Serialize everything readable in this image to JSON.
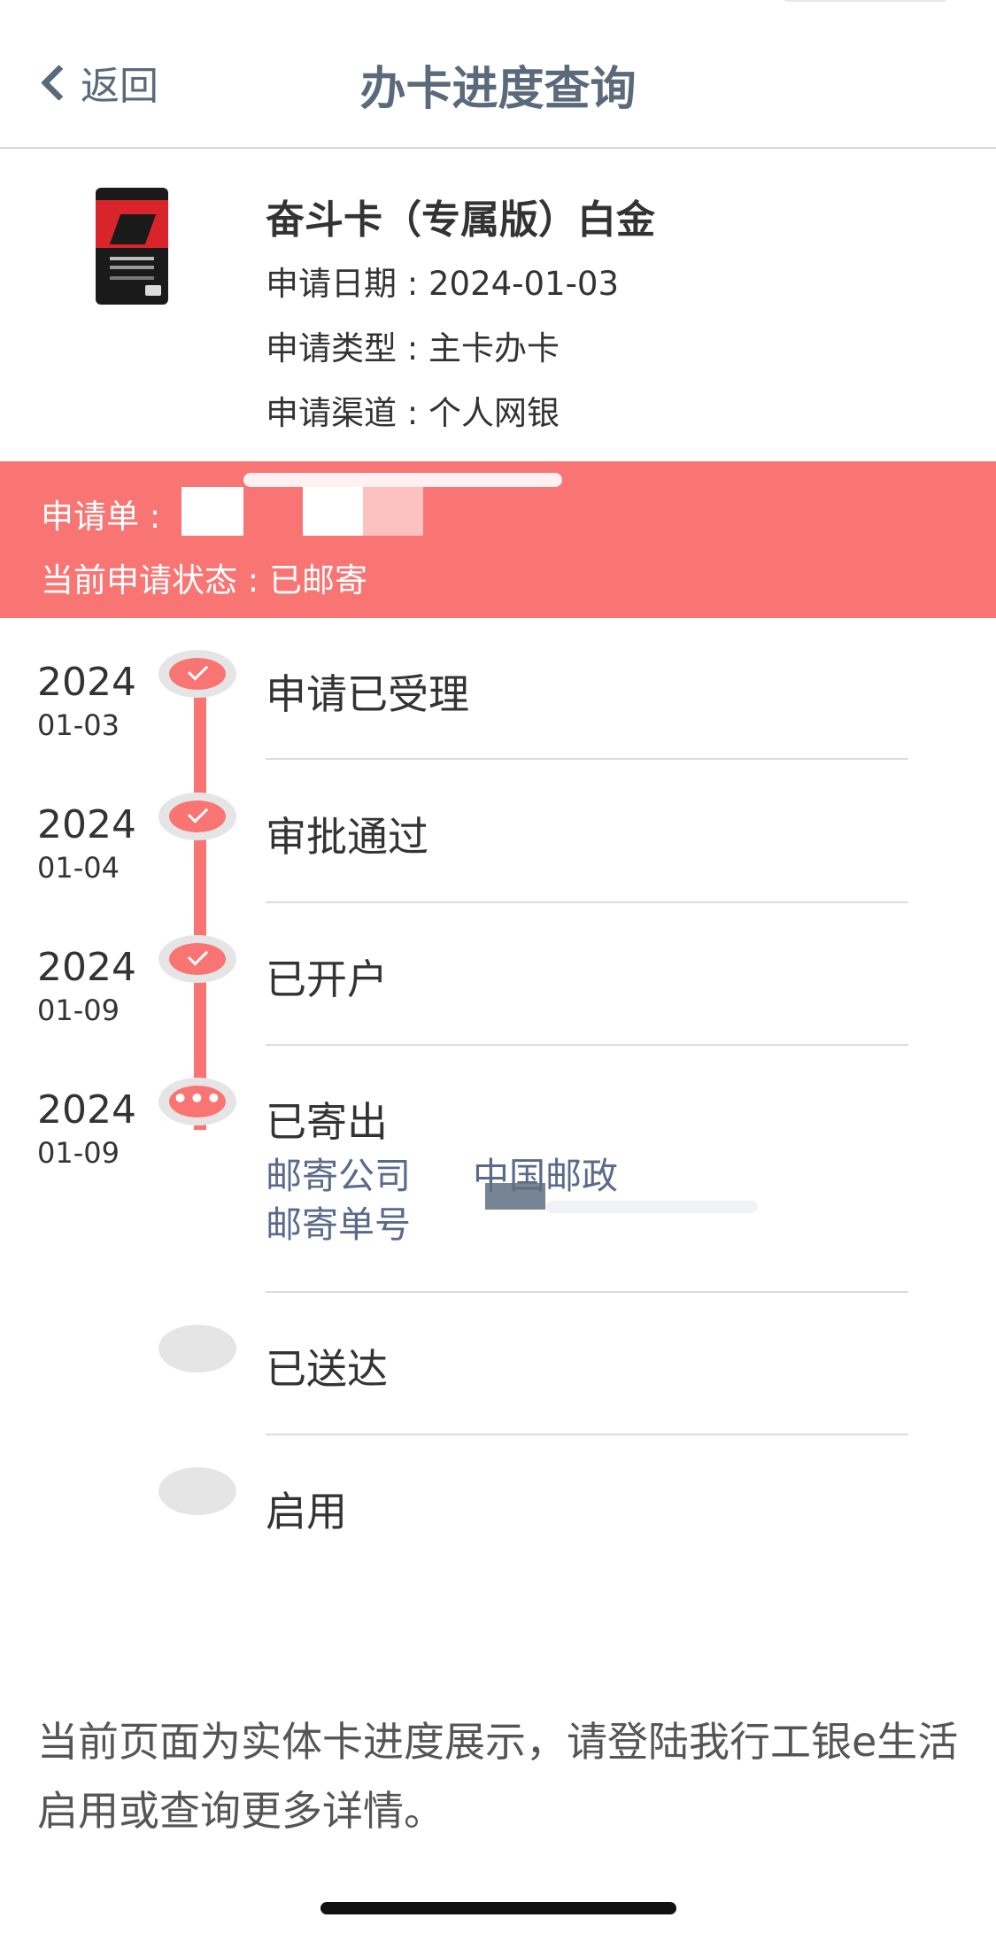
{
  "nav": {
    "back_label": "返回",
    "title": "办卡进度查询"
  },
  "card": {
    "name": "奋斗卡（专属版）白金",
    "apply_date": "申请日期 : 2024-01-03",
    "apply_type": "申请类型 : 主卡办卡",
    "apply_channel": "申请渠道 : 个人网银"
  },
  "banner": {
    "order_label": "申请单 :",
    "status": "当前申请状态 : 已邮寄"
  },
  "timeline": [
    {
      "year": "2024",
      "date": "01-03",
      "label": "申请已受理",
      "state": "done"
    },
    {
      "year": "2024",
      "date": "01-04",
      "label": "审批通过",
      "state": "done"
    },
    {
      "year": "2024",
      "date": "01-09",
      "label": "已开户",
      "state": "done"
    },
    {
      "year": "2024",
      "date": "01-09",
      "label": "已寄出",
      "state": "current"
    },
    {
      "label": "已送达",
      "state": "pending"
    },
    {
      "label": "启用",
      "state": "pending"
    }
  ],
  "mail": {
    "company_key": "邮寄公司",
    "company_value": "中国邮政",
    "number_key": "邮寄单号"
  },
  "note": "当前页面为实体卡进度展示，请登陆我行工银e生活启用或查询更多详情。",
  "colors": {
    "accent": "#f87574",
    "nav_text": "#5a6a7a",
    "detail_text": "#5a6a8a"
  }
}
